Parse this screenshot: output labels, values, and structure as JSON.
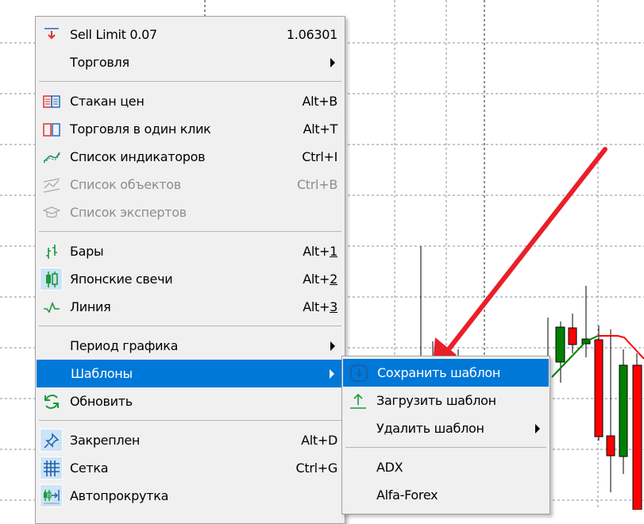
{
  "main_menu": {
    "items": [
      {
        "label": "Sell Limit 0.07",
        "shortcut": "1.06301",
        "icon": "sell-limit-icon"
      },
      {
        "label": "Торговля",
        "submenu": true
      },
      {
        "label": "Стакан цен",
        "shortcut": "Alt+B",
        "icon": "depth-of-market-icon"
      },
      {
        "label": "Торговля в один клик",
        "shortcut": "Alt+T",
        "icon": "one-click-trading-icon"
      },
      {
        "label": "Список индикаторов",
        "shortcut": "Ctrl+I",
        "icon": "indicators-list-icon"
      },
      {
        "label": "Список объектов",
        "shortcut": "Ctrl+B",
        "icon": "objects-list-icon",
        "disabled": true
      },
      {
        "label": "Список экспертов",
        "icon": "experts-list-icon",
        "disabled": true
      },
      {
        "label": "Бары",
        "shortcut_prefix": "Alt+",
        "shortcut_key": "1",
        "icon": "bars-icon"
      },
      {
        "label": "Японские свечи",
        "shortcut_prefix": "Alt+",
        "shortcut_key": "2",
        "icon": "candlesticks-icon",
        "checked": true
      },
      {
        "label": "Линия",
        "shortcut_prefix": "Alt+",
        "shortcut_key": "3",
        "icon": "line-chart-icon"
      },
      {
        "label": "Период графика",
        "submenu": true
      },
      {
        "label": "Шаблоны",
        "submenu": true,
        "highlighted": true
      },
      {
        "label": "Обновить",
        "icon": "refresh-icon"
      },
      {
        "label": "Закреплен",
        "shortcut": "Alt+D",
        "icon": "pin-icon",
        "checked": true
      },
      {
        "label": "Сетка",
        "shortcut": "Ctrl+G",
        "icon": "grid-icon",
        "checked": true
      },
      {
        "label": "Автопрокрутка",
        "icon": "autoscroll-icon",
        "checked": true
      }
    ]
  },
  "templates_submenu": {
    "items": [
      {
        "label": "Сохранить шаблон",
        "icon": "save-template-icon",
        "highlighted": true
      },
      {
        "label": "Загрузить шаблон",
        "icon": "load-template-icon"
      },
      {
        "label": "Удалить шаблон",
        "submenu": true
      },
      {
        "label": "ADX"
      },
      {
        "label": "Alfa-Forex"
      }
    ]
  },
  "colors": {
    "highlight": "#0078d7",
    "bull": "#008000",
    "bear": "#ff0000",
    "annotation_arrow": "#e8202a"
  }
}
